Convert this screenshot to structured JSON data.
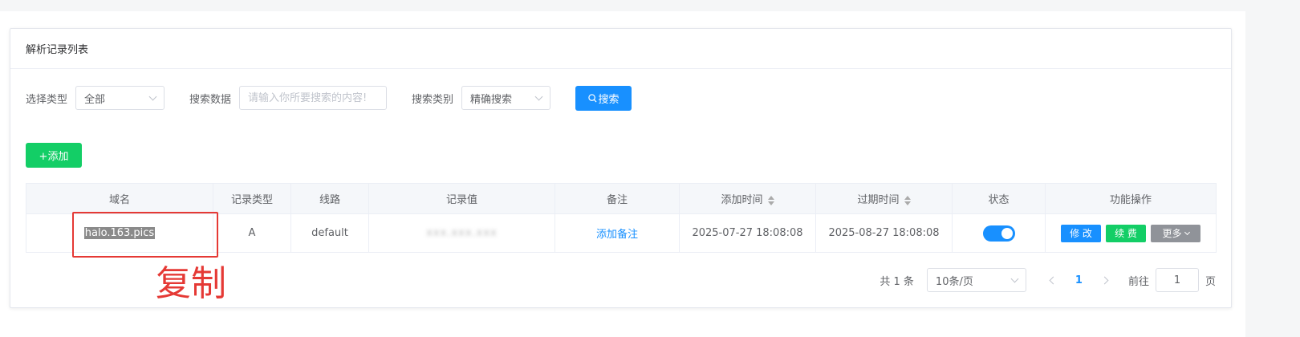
{
  "panel": {
    "title": "解析记录列表"
  },
  "filters": {
    "type_label": "选择类型",
    "type_value": "全部",
    "data_label": "搜索数据",
    "data_placeholder": "请输入你所要搜索的内容!",
    "category_label": "搜索类别",
    "category_value": "精确搜索",
    "search_button": "搜索"
  },
  "add_button": "+添加",
  "table": {
    "headers": {
      "domain": "域名",
      "record_type": "记录类型",
      "line": "线路",
      "record_value": "记录值",
      "remark": "备注",
      "add_time": "添加时间",
      "expire_time": "过期时间",
      "status": "状态",
      "actions": "功能操作"
    },
    "rows": [
      {
        "domain": "halo.163.pics",
        "record_type": "A",
        "line": "default",
        "record_value": "xxx.xxx.xxx",
        "remark_link": "添加备注",
        "add_time": "2025-07-27 18:08:08",
        "expire_time": "2025-08-27 18:08:08",
        "status_on": true,
        "edit_label": "修 改",
        "renew_label": "续 费",
        "more_label": "更多"
      }
    ]
  },
  "annotation": {
    "text": "复制"
  },
  "pagination": {
    "total_text": "共 1 条",
    "page_size": "10条/页",
    "current_page": "1",
    "goto_label": "前往",
    "goto_value": "1",
    "page_suffix": "页"
  },
  "colors": {
    "primary": "#1890ff",
    "success": "#13ce66",
    "gray": "#909399",
    "annotation": "#e53935"
  }
}
